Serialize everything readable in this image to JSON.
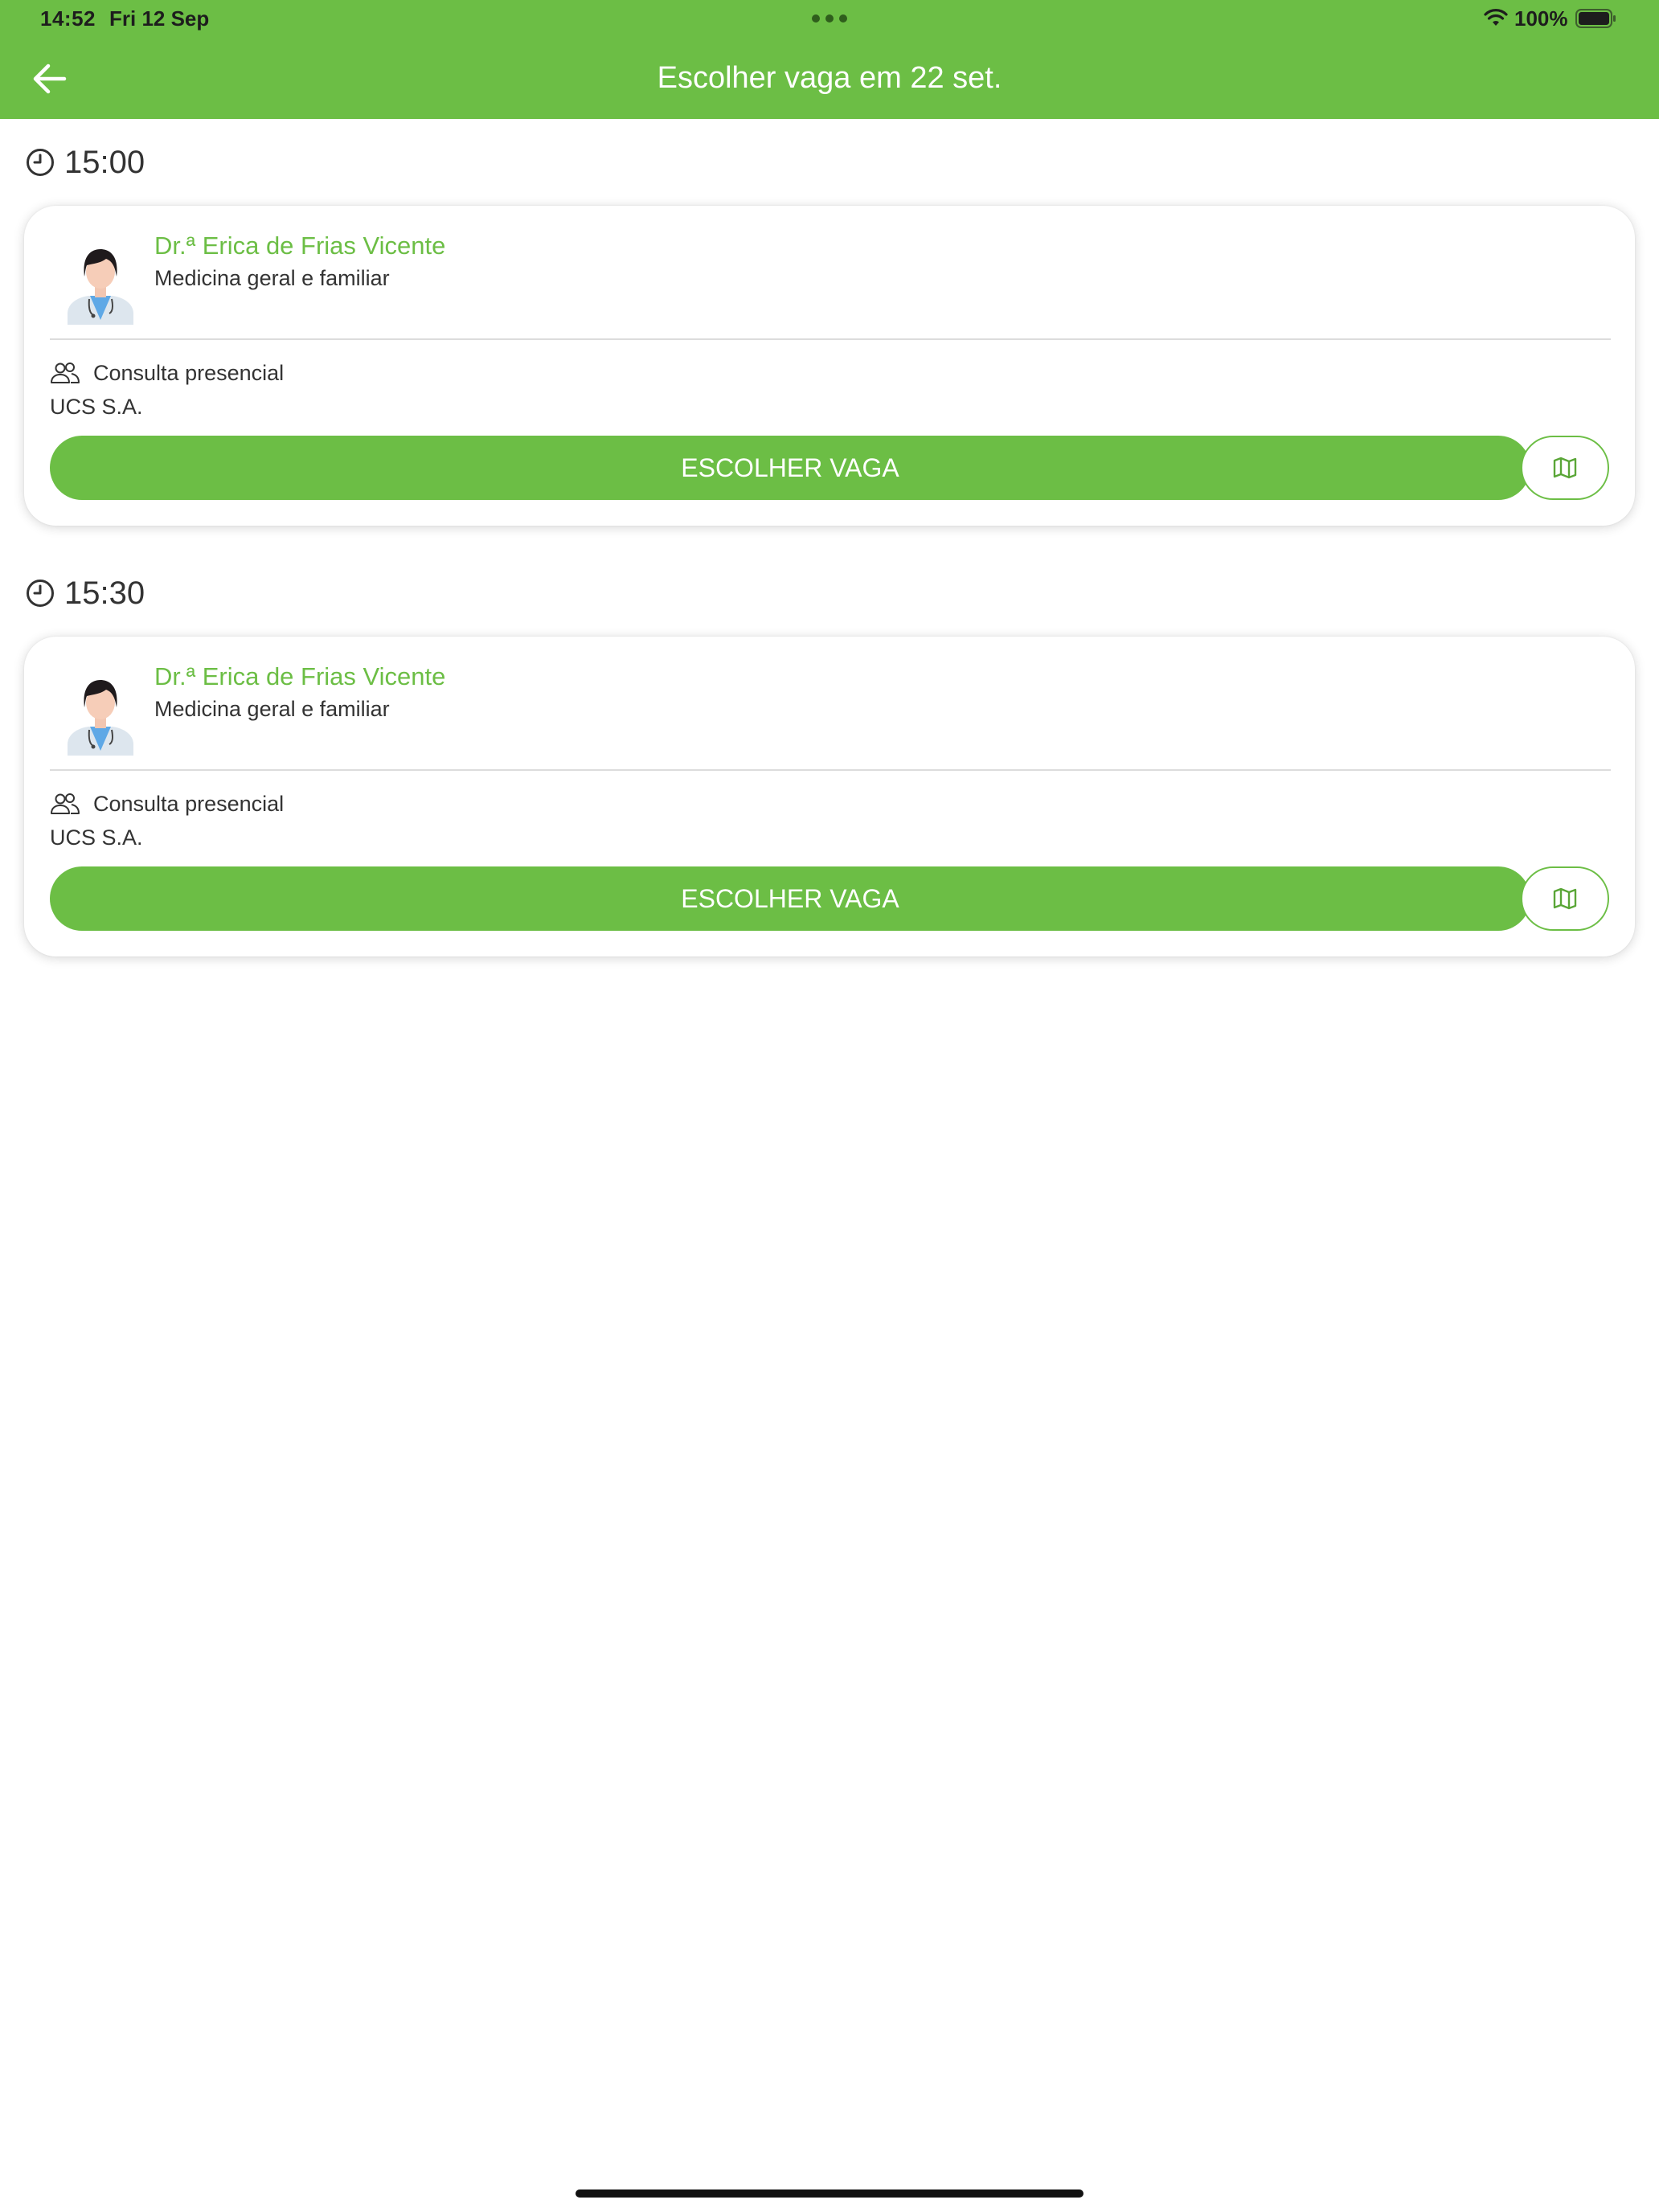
{
  "status_bar": {
    "time": "14:52",
    "date": "Fri 12 Sep",
    "battery": "100%"
  },
  "header": {
    "title": "Escolher vaga em 22 set."
  },
  "slots": [
    {
      "time": "15:00",
      "doctor_name": "Dr.ª Erica de Frias Vicente",
      "specialty": "Medicina geral e familiar",
      "consultation_type": "Consulta presencial",
      "provider": "UCS S.A.",
      "button_label": "ESCOLHER VAGA"
    },
    {
      "time": "15:30",
      "doctor_name": "Dr.ª Erica de Frias Vicente",
      "specialty": "Medicina geral e familiar",
      "consultation_type": "Consulta presencial",
      "provider": "UCS S.A.",
      "button_label": "ESCOLHER VAGA"
    }
  ],
  "icons": {
    "back": "arrow-left-icon",
    "clock": "clock-icon",
    "people": "people-icon",
    "map": "map-icon",
    "wifi": "wifi-icon",
    "battery": "battery-icon"
  },
  "colors": {
    "brand_green": "#6cbe45",
    "text": "#333333",
    "card_bg": "#ffffff"
  }
}
